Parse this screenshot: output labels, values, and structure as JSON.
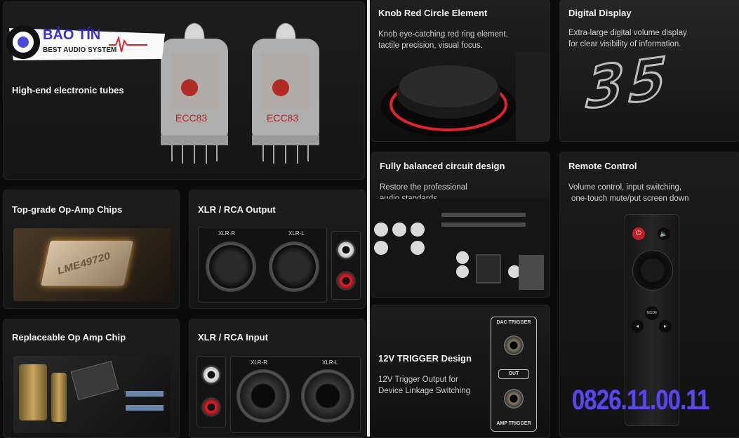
{
  "brand": {
    "name": "BẢO TÍN",
    "tagline": "BEST AUDIO SYSTEM"
  },
  "phone": "0826.11.00.11",
  "cards": {
    "tubes": {
      "title": "High-end electronic tubes",
      "tube_label": "ECC83"
    },
    "opamp": {
      "title": "Top-grade Op-Amp Chips",
      "chip_label": "LME49720"
    },
    "xlr_out": {
      "title": "XLR / RCA Output",
      "left_label": "XLR-R",
      "right_label": "XLR-L"
    },
    "replace": {
      "title": "Replaceable Op Amp Chip"
    },
    "xlr_in": {
      "title": "XLR / RCA Input",
      "left_label": "XLR-R",
      "right_label": "XLR-L"
    },
    "knob": {
      "title": "Knob Red Circle Element",
      "desc1": "Knob eye-catching red ring element,",
      "desc2": "tactile precision, visual focus."
    },
    "display": {
      "title": "Digital Display",
      "desc1": "Extra-large digital volume display",
      "desc2": "for clear visibility of information.",
      "value": "35"
    },
    "balanced": {
      "title": "Fully balanced circuit design",
      "desc1": "Restore the professional",
      "desc2": "audio standards."
    },
    "remote": {
      "title": "Remote Control",
      "desc1": "Volume control, input switching,",
      "desc2": "one-touch mute/put screen down",
      "mode_label": "MODE"
    },
    "trigger": {
      "title": "12V TRIGGER Design",
      "desc1": "12V Trigger Output for",
      "desc2": "Device Linkage Switching",
      "dac_label": "DAC TRIGGER",
      "out_label": "OUT",
      "amp_label": "AMP TRIGGER"
    }
  },
  "colors": {
    "accent_red": "#e0242a",
    "phone_purple": "#5a48e6",
    "card_bg": "#1a1a1a"
  }
}
